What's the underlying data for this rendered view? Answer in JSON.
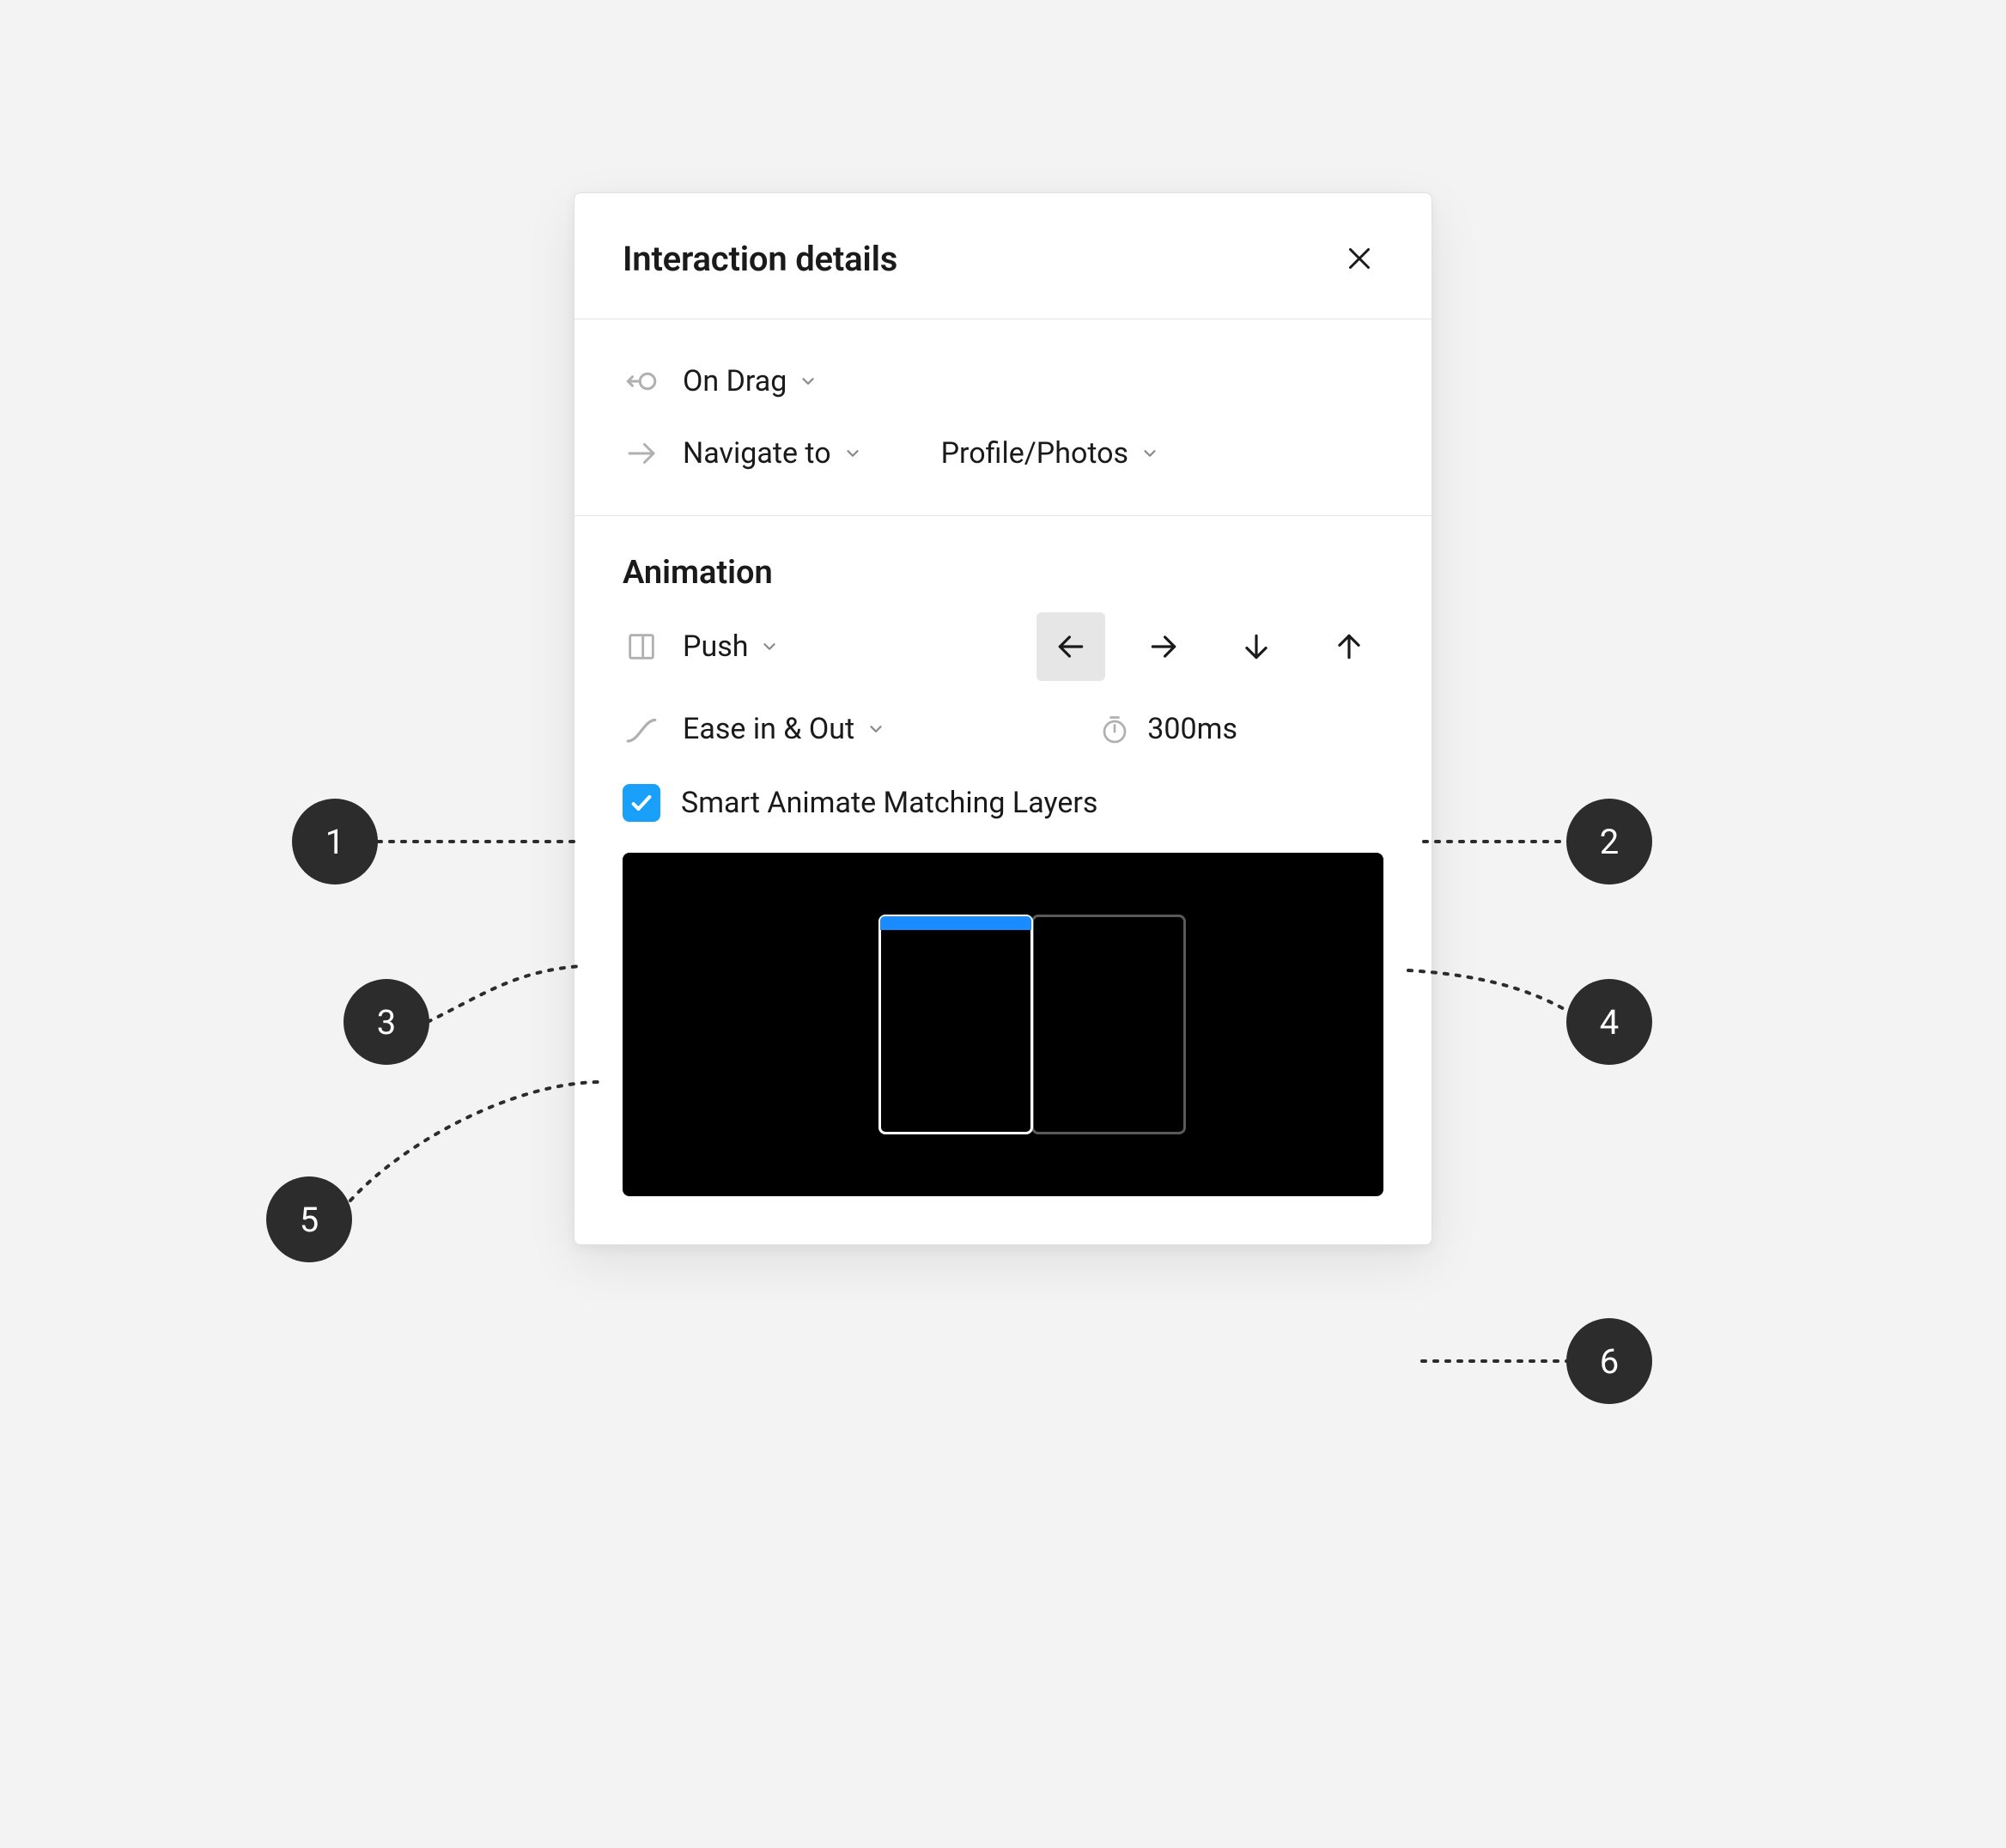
{
  "panel": {
    "title": "Interaction details"
  },
  "trigger": {
    "label": "On Drag"
  },
  "action": {
    "type_label": "Navigate to",
    "destination_label": "Profile/Photos"
  },
  "animation": {
    "section_title": "Animation",
    "transition_label": "Push",
    "direction_selected": "left",
    "easing_label": "Ease in & Out",
    "duration_label": "300ms",
    "smart_animate_label": "Smart Animate Matching Layers",
    "smart_animate_checked": true
  },
  "callouts": {
    "c1": "1",
    "c2": "2",
    "c3": "3",
    "c4": "4",
    "c5": "5",
    "c6": "6"
  }
}
